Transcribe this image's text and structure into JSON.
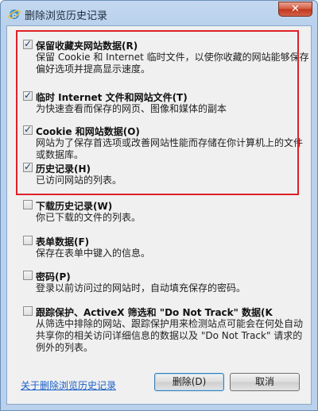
{
  "window": {
    "title": "删除浏览历史记录",
    "close_symbol": "✕"
  },
  "items": [
    {
      "label": "保留收藏夹网站数据(R)",
      "description": "保留 Cookie 和 Internet 临时文件，以使你收藏的网站能够保存偏好选项并提高显示速度。",
      "checked": true
    },
    {
      "label": "临时 Internet 文件和网站文件(T)",
      "description": "为快速查看而保存的网页、图像和媒体的副本",
      "checked": true
    },
    {
      "label": "Cookie 和网站数据(O)",
      "description": "网站为了保存首选项或改善网站性能而存储在你计算机上的文件或数据库。",
      "checked": true
    },
    {
      "label": "历史记录(H)",
      "description": "已访问网站的列表。",
      "checked": true
    },
    {
      "label": "下载历史记录(W)",
      "description": "你已下载的文件的列表。",
      "checked": false
    },
    {
      "label": "表单数据(F)",
      "description": "保存在表单中键入的信息。",
      "checked": false
    },
    {
      "label": "密码(P)",
      "description": "登录以前访问过的网站时，自动填充保存的密码。",
      "checked": false
    },
    {
      "label": "跟踪保护、ActiveX 筛选和 \"Do Not Track\" 数据(K",
      "description": "从筛选中排除的网站、跟踪保护用来检测站点可能会在何处自动共享你的相关访问详细信息的数据以及 \"Do Not Track\" 请求的例外的列表。",
      "checked": false
    }
  ],
  "footer": {
    "about_link": "关于删除浏览历史记录",
    "delete_label": "删除(D)",
    "cancel_label": "取消"
  }
}
